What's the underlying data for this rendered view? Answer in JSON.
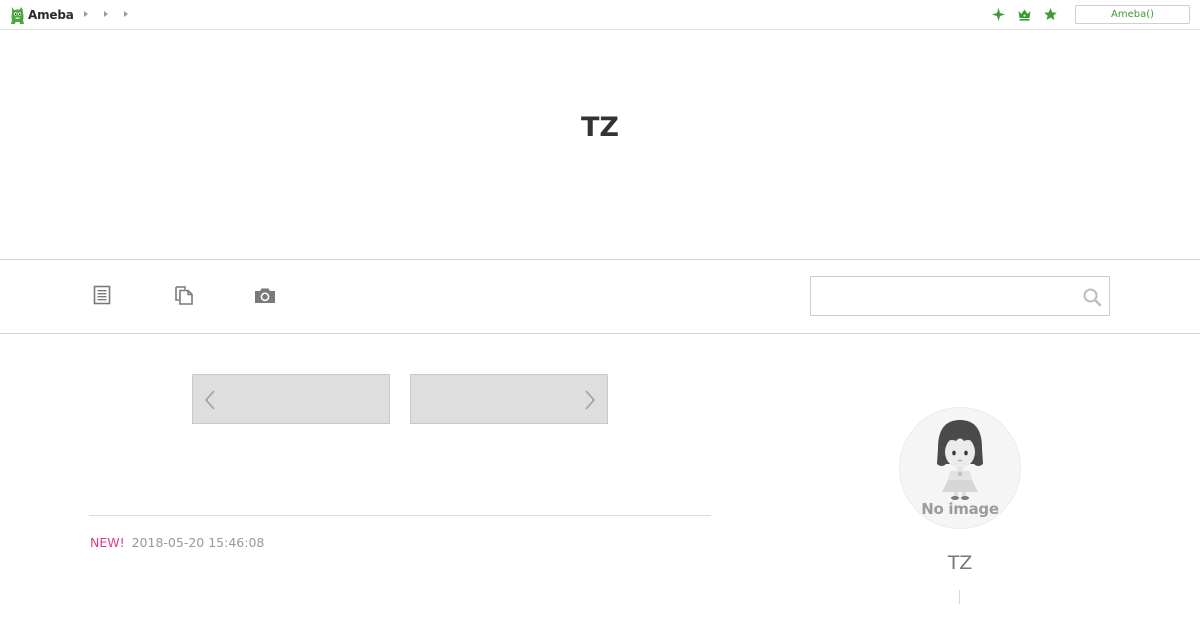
{
  "topbar": {
    "logo_text": "Ameba",
    "breadcrumb_arrows": 3,
    "icons": [
      "sparkle-icon",
      "crown-icon",
      "star-icon"
    ],
    "ameba_button_label": "Ameba()",
    "accent_color": "#3d9b35"
  },
  "header": {
    "blog_title": "TZ"
  },
  "nav": {
    "icons": [
      "entries-list-icon",
      "theme-pages-icon",
      "camera-icon"
    ],
    "search": {
      "value": "",
      "placeholder": ""
    }
  },
  "main": {
    "pager": {
      "prev_icon": "chevron-left-icon",
      "next_icon": "chevron-right-icon"
    },
    "entry": {
      "new_label": "NEW!",
      "date": "2018-05-20 15:46:08",
      "new_color": "#e0388f"
    }
  },
  "sidebar": {
    "profile": {
      "avatar_label": "No image",
      "name": "TZ"
    }
  }
}
